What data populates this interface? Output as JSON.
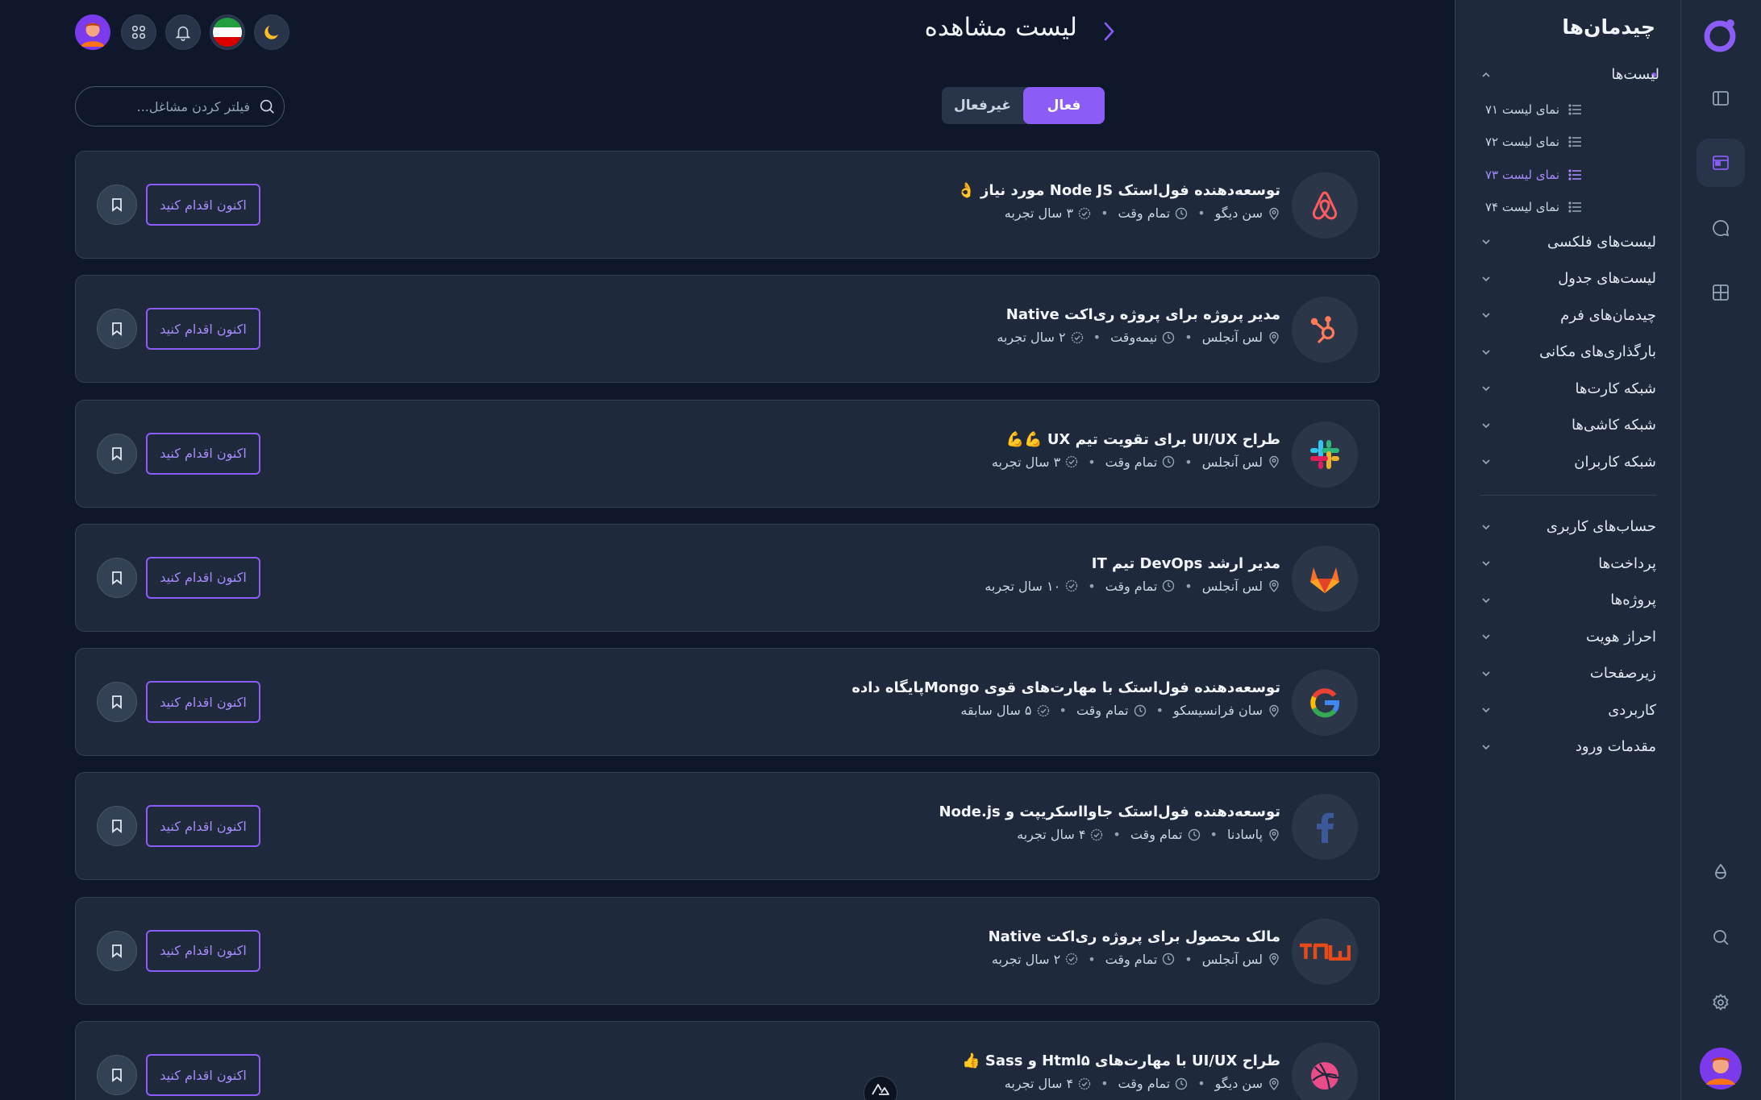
{
  "sidebar": {
    "title": "چیدمان‌ها",
    "items": [
      {
        "label": "لیست‌ها",
        "expanded": true,
        "subitems": [
          {
            "label": "نمای لیست ۷۱",
            "active": false
          },
          {
            "label": "نمای لیست ۷۲",
            "active": false
          },
          {
            "label": "نمای لیست ۷۳",
            "active": true
          },
          {
            "label": "نمای لیست ۷۴",
            "active": false
          }
        ]
      },
      {
        "label": "لیست‌های فلکسی"
      },
      {
        "label": "لیست‌های جدول"
      },
      {
        "label": "چیدمان‌های فرم"
      },
      {
        "label": "بارگذاری‌های مکانی"
      },
      {
        "label": "شبکه کارت‌ها"
      },
      {
        "label": "شبکه کاشی‌ها"
      },
      {
        "label": "شبکه کاربران"
      }
    ],
    "items2": [
      {
        "label": "حساب‌های کاربری"
      },
      {
        "label": "پرداخت‌ها"
      },
      {
        "label": "پروژه‌ها"
      },
      {
        "label": "احراز هویت"
      },
      {
        "label": "زیرصفحات"
      },
      {
        "label": "کاربردی"
      },
      {
        "label": "مقدمات ورود"
      }
    ]
  },
  "header": {
    "title": "لیست مشاهده"
  },
  "tabs": [
    {
      "label": "فعال",
      "active": true
    },
    {
      "label": "غیرفعال",
      "active": false
    }
  ],
  "search": {
    "placeholder": "فیلتر کردن مشاغل...",
    "value": ""
  },
  "jobs": [
    {
      "logo": "airbnb-logo",
      "title": "توسعه‌دهنده فول‌استک Node JS مورد نیاز 👌",
      "location": "سن دیگو",
      "type": "تمام وقت",
      "experience": "۳ سال تجربه",
      "apply_label": "اکنون اقدام کنید"
    },
    {
      "logo": "hubspot-logo",
      "title": "مدیر پروژه برای پروژه ری‌اکت Native",
      "location": "لس آنجلس",
      "type": "نیمه‌وقت",
      "experience": "۲ سال تجربه",
      "apply_label": "اکنون اقدام کنید"
    },
    {
      "logo": "slack-logo",
      "title": "طراح UI/UX برای تقویت تیم UX 💪💪",
      "location": "لس آنجلس",
      "type": "تمام وقت",
      "experience": "۳ سال تجربه",
      "apply_label": "اکنون اقدام کنید"
    },
    {
      "logo": "gitlab-logo",
      "title": "مدیر ارشد DevOps تیم IT",
      "location": "لس آنجلس",
      "type": "تمام وقت",
      "experience": "۱۰ سال تجربه",
      "apply_label": "اکنون اقدام کنید"
    },
    {
      "logo": "google-logo",
      "title": "توسعه‌دهنده فول‌استک با مهارت‌های قوی Mongoپایگاه داده",
      "location": "سان فرانسیسکو",
      "type": "تمام وقت",
      "experience": "۵ سال سابقه",
      "apply_label": "اکنون اقدام کنید"
    },
    {
      "logo": "facebook-logo",
      "title": "توسعه‌دهنده فول‌استک جاوااسکریپت و Node.js",
      "location": "پاسادنا",
      "type": "تمام وقت",
      "experience": "۴ سال تجربه",
      "apply_label": "اکنون اقدام کنید"
    },
    {
      "logo": "tnw-logo",
      "title": "مالک محصول برای پروژه ری‌اکت Native",
      "location": "لس آنجلس",
      "type": "تمام وقت",
      "experience": "۲ سال تجربه",
      "apply_label": "اکنون اقدام کنید"
    },
    {
      "logo": "dribbble-logo",
      "title": "طراح UI/UX با مهارت‌های Html۵ و Sass 👍",
      "location": "سن دیگو",
      "type": "تمام وقت",
      "experience": "۴ سال تجربه",
      "apply_label": "اکنون اقدام کنید"
    }
  ],
  "colors": {
    "accent": "#8b5cf6",
    "background": "#0f172a",
    "panel": "#1e293b"
  }
}
